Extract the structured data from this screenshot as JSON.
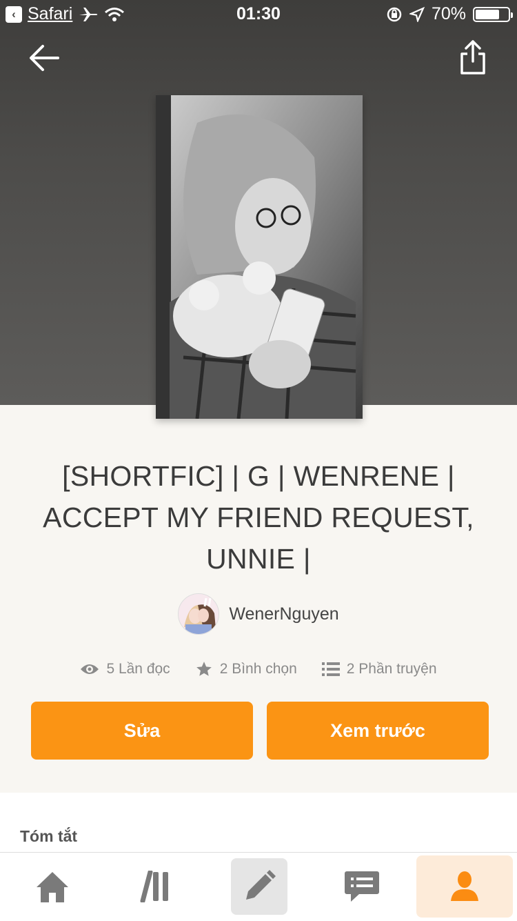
{
  "status_bar": {
    "back_app_label": "Safari",
    "time": "01:30",
    "battery_percent": "70%",
    "battery_level": 0.7
  },
  "story": {
    "title": "[SHORTFIC] | G | WENRENE | ACCEPT MY FRIEND REQUEST, UNNIE |",
    "author": "WenerNguyen",
    "stats": {
      "reads": "5 Lần đọc",
      "votes": "2 Bình chọn",
      "parts": "2 Phần truyện"
    }
  },
  "buttons": {
    "edit": "Sửa",
    "preview": "Xem trước"
  },
  "summary": {
    "heading": "Tóm tắt"
  },
  "colors": {
    "accent": "#fb9414",
    "hero_bg": "#4d4c4a",
    "page_bg": "#f8f6f2"
  },
  "icons": {
    "back": "arrow-left-icon",
    "share": "share-icon",
    "reads": "eye-icon",
    "votes": "star-icon",
    "parts": "list-icon",
    "tabs": [
      "home-icon",
      "library-icon",
      "pencil-icon",
      "messages-icon",
      "profile-icon"
    ]
  }
}
